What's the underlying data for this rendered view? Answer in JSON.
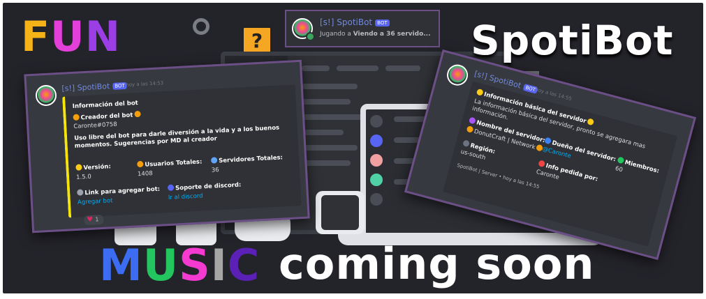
{
  "headline": {
    "fun": [
      "F",
      "U",
      "N"
    ],
    "spotibot": "SpotiBot",
    "music": [
      "M",
      "U",
      "S",
      "I",
      "C"
    ],
    "soon": "coming soon"
  },
  "status_card": {
    "username": "[s!] SpotiBot",
    "badge": "BOT",
    "activity_prefix": "Jugando a ",
    "activity_bold": "Viendo a 36 servido..."
  },
  "info_card": {
    "username": "[s!] SpotiBot",
    "badge": "BOT",
    "timestamp": "hoy a las 14:53",
    "title": "Información del bot",
    "creator_label": "Creador del bot",
    "creator_value": "Caronte#0758",
    "description": "Uso libre del bot para darle diversión a la vida y a los buenos momentos. Sugerencias por MD al creador",
    "fields": [
      {
        "label": "Versión:",
        "value": "1.5.0"
      },
      {
        "label": "Usuarios Totales:",
        "value": "1408"
      },
      {
        "label": "Servidores Totales:",
        "value": "36"
      }
    ],
    "link_add_label": "Link para agregar bot:",
    "link_add_value": "Agregar bot",
    "support_label": "Soporte de discord:",
    "support_value": "Ir al discord",
    "reaction_count": "1"
  },
  "server_card": {
    "username": "[s!] SpotiBot",
    "badge": "BOT",
    "timestamp": "hoy a las 14:55",
    "title": "Información básica del servidor",
    "subtitle": "La información básica del servidor, pronto se agregara mas información.",
    "server_name_label": "Nombre del servidor:",
    "server_name_value": "DonutCraft | Network",
    "owner_label": "Dueño del servidor:",
    "owner_value": "@Caronte",
    "members_label": "Miembros:",
    "members_value": "60",
    "region_label": "Región:",
    "region_value": "us-south",
    "requested_label": "Info pedida por:",
    "requested_value": "Caronte",
    "footer": "SpotiBot | Server • hoy a las 14:55"
  },
  "colors": {
    "background": "#23232a",
    "card": "#36393f",
    "embed_accent": "#f5e50b",
    "username": "#7289da",
    "link": "#00aff4"
  }
}
